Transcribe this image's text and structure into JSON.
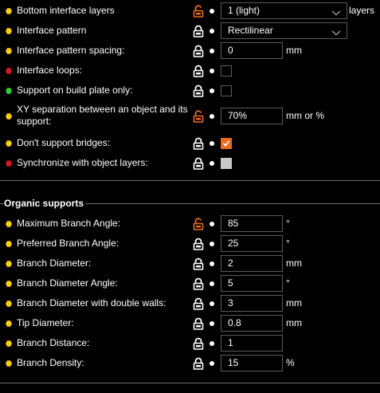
{
  "support_rows": [
    {
      "label": "Bottom interface layers",
      "bullet": "yellow",
      "lock": "unlocked",
      "type": "combo",
      "value": "1 (light)",
      "unit": "layers"
    },
    {
      "label": "Interface pattern",
      "bullet": "yellow",
      "lock": "locked",
      "type": "combo",
      "value": "Rectilinear",
      "unit": ""
    },
    {
      "label": "Interface pattern spacing:",
      "bullet": "yellow",
      "lock": "locked",
      "type": "field",
      "value": "0",
      "unit": "mm"
    },
    {
      "label": "Interface loops:",
      "bullet": "red",
      "lock": "locked",
      "type": "check",
      "checked": false
    },
    {
      "label": "Support on build plate only:",
      "bullet": "green",
      "lock": "locked",
      "type": "check",
      "checked": false
    },
    {
      "label": "XY separation between an object and its support:",
      "bullet": "yellow",
      "lock": "unlocked",
      "type": "field",
      "value": "70%",
      "unit": "mm or %"
    },
    {
      "label": "Don't support bridges:",
      "bullet": "yellow",
      "lock": "locked",
      "type": "check",
      "checked": true
    },
    {
      "label": "Synchronize with object layers:",
      "bullet": "red",
      "lock": "locked",
      "type": "check",
      "checked": false,
      "disabled": true
    }
  ],
  "organic": {
    "title": "Organic supports",
    "rows": [
      {
        "label": "Maximum Branch Angle:",
        "bullet": "yellow",
        "lock": "unlocked",
        "value": "85",
        "unit": "°"
      },
      {
        "label": "Preferred Branch Angle:",
        "bullet": "yellow",
        "lock": "locked",
        "value": "25",
        "unit": "°"
      },
      {
        "label": "Branch Diameter:",
        "bullet": "yellow",
        "lock": "locked",
        "value": "2",
        "unit": "mm"
      },
      {
        "label": "Branch Diameter Angle:",
        "bullet": "yellow",
        "lock": "locked",
        "value": "5",
        "unit": "°"
      },
      {
        "label": "Branch Diameter with double walls:",
        "bullet": "yellow",
        "lock": "locked",
        "value": "3",
        "unit": "mm"
      },
      {
        "label": "Tip Diameter:",
        "bullet": "yellow",
        "lock": "locked",
        "value": "0.8",
        "unit": "mm"
      },
      {
        "label": "Branch Distance:",
        "bullet": "yellow",
        "lock": "locked",
        "value": "1",
        "unit": ""
      },
      {
        "label": "Branch Density:",
        "bullet": "yellow",
        "lock": "locked",
        "value": "15",
        "unit": "%"
      }
    ]
  },
  "colors": {
    "accent_orange": "#ed6b21",
    "bullet_yellow": "#ffd000",
    "bullet_red": "#e0141e",
    "bullet_green": "#2fd02f"
  }
}
